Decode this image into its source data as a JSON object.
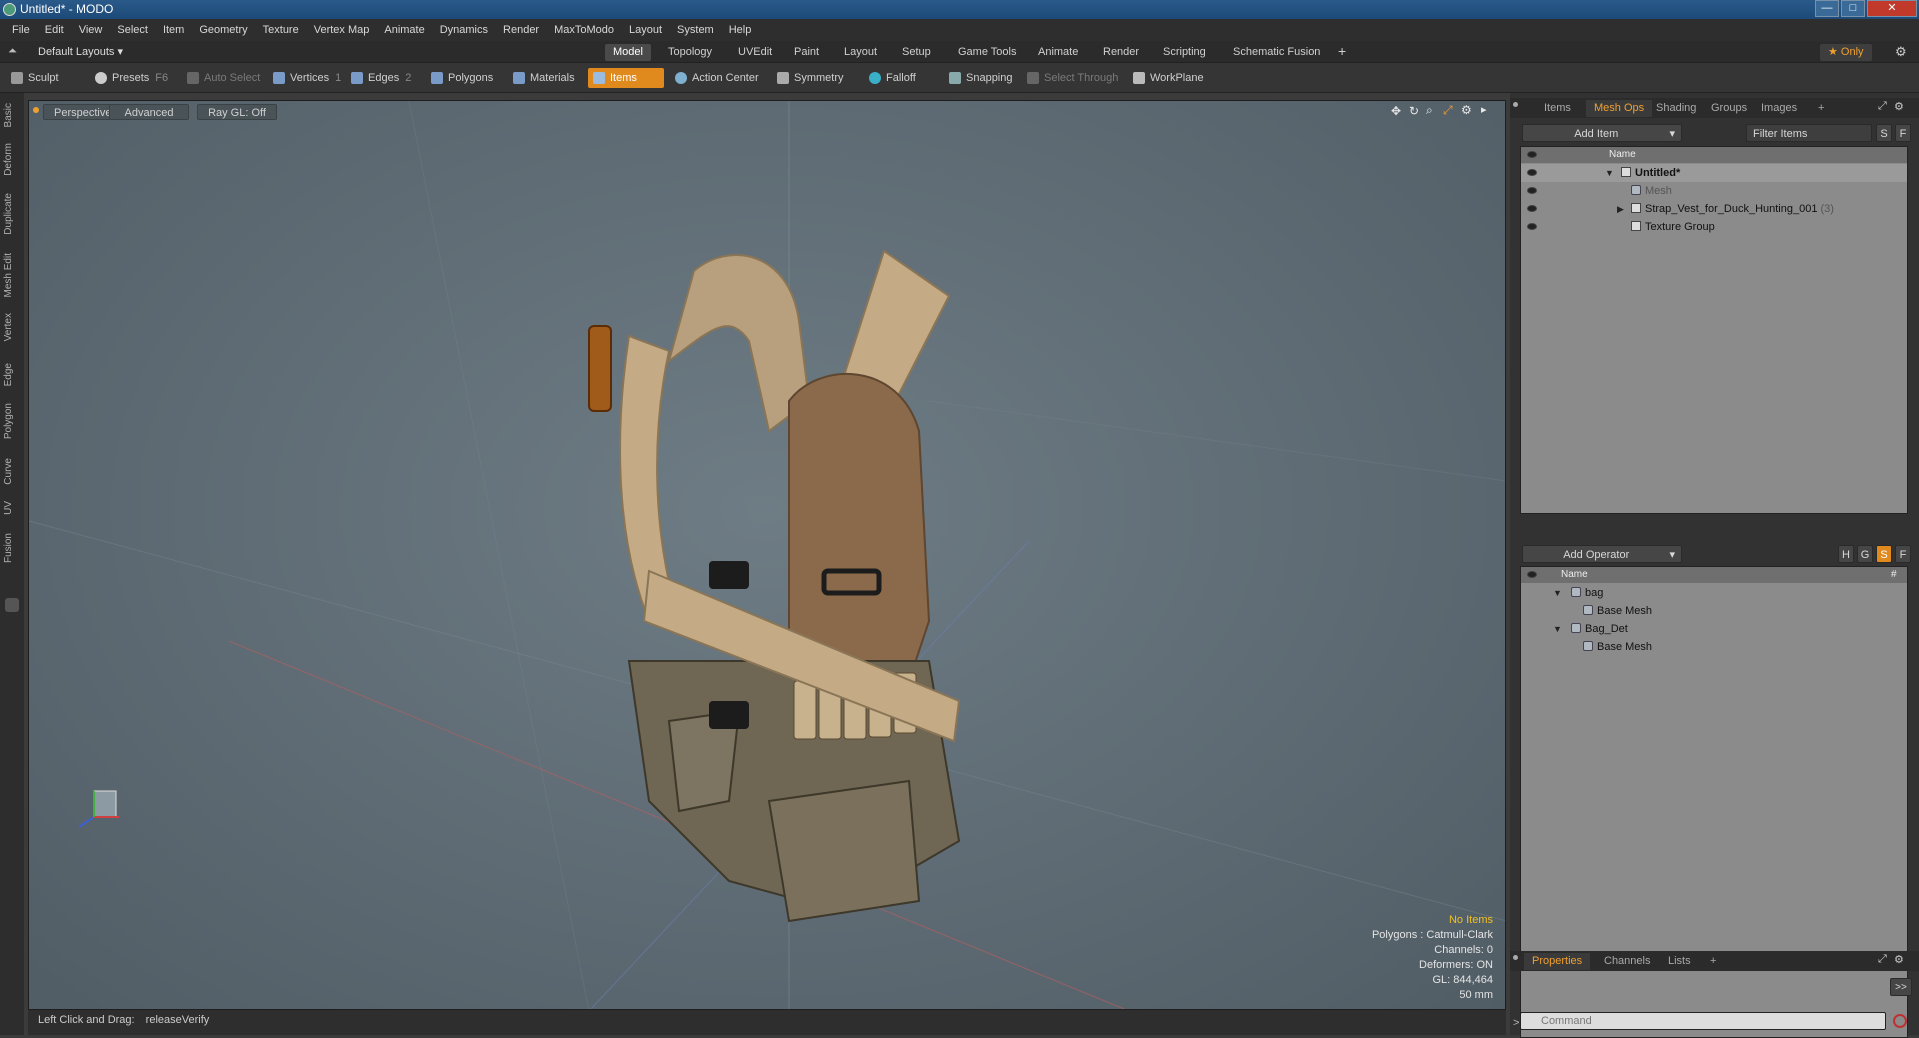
{
  "window": {
    "title": "Untitled* - MODO",
    "min_glyph": "—",
    "max_glyph": "□",
    "close_glyph": "✕"
  },
  "menu": [
    "File",
    "Edit",
    "View",
    "Select",
    "Item",
    "Geometry",
    "Texture",
    "Vertex Map",
    "Animate",
    "Dynamics",
    "Render",
    "MaxToModo",
    "Layout",
    "System",
    "Help"
  ],
  "layouts": {
    "selector": "Default Layouts",
    "tabs": [
      "Model",
      "Topology",
      "UVEdit",
      "Paint",
      "Layout",
      "Setup",
      "Game Tools",
      "Animate",
      "Render",
      "Scripting",
      "Schematic Fusion"
    ],
    "active": "Model",
    "add": "+",
    "only_label": "★ Only"
  },
  "toolbar": {
    "sculpt": "Sculpt",
    "presets": "Presets",
    "presets_key": "F6",
    "auto_select": "Auto Select",
    "vertices": "Vertices",
    "vertices_key": "1",
    "edges": "Edges",
    "edges_key": "2",
    "polygons": "Polygons",
    "materials": "Materials",
    "items": "Items",
    "action_center": "Action Center",
    "symmetry": "Symmetry",
    "falloff": "Falloff",
    "snapping": "Snapping",
    "select_through": "Select Through",
    "workplane": "WorkPlane"
  },
  "left_tabs": [
    "Basic",
    "Deform",
    "Duplicate",
    "Mesh Edit",
    "Vertex",
    "Edge",
    "Polygon",
    "Curve",
    "UV",
    "Fusion"
  ],
  "viewport": {
    "view": "Perspective",
    "shading": "Advanced",
    "raygl": "Ray GL: Off",
    "info": {
      "selection": "No Items",
      "polygons": "Polygons : Catmull-Clark",
      "channels": "Channels: 0",
      "deformers": "Deformers: ON",
      "gl": "GL: 844,464",
      "scale": "50 mm"
    }
  },
  "status": {
    "hint": "Left Click and Drag:",
    "action": "releaseVerify"
  },
  "items_panel": {
    "tabs": [
      "Items",
      "Mesh Ops",
      "Shading",
      "Groups",
      "Images",
      "+"
    ],
    "active": "Mesh Ops",
    "add_item": "Add Item",
    "filter_placeholder": "Filter Items",
    "s_btn": "S",
    "f_btn": "F",
    "col_name": "Name",
    "rows": [
      {
        "name": "Untitled*",
        "depth": 0
      },
      {
        "name": "Mesh",
        "depth": 1
      },
      {
        "name": "Strap_Vest_for_Duck_Hunting_001",
        "count": "(3)",
        "depth": 1
      },
      {
        "name": "Texture Group",
        "depth": 1
      }
    ]
  },
  "meshops_panel": {
    "add_operator": "Add Operator",
    "btn_h": "H",
    "btn_g": "G",
    "btn_s": "S",
    "btn_f": "F",
    "col_name": "Name",
    "col_hash": "#",
    "rows": [
      {
        "name": "bag",
        "depth": 0
      },
      {
        "name": "Base Mesh",
        "depth": 1
      },
      {
        "name": "Bag_Det",
        "depth": 0
      },
      {
        "name": "Base Mesh",
        "depth": 1
      }
    ]
  },
  "properties_panel": {
    "tabs": [
      "Properties",
      "Channels",
      "Lists",
      "+"
    ],
    "active": "Properties",
    "expand": ">>"
  },
  "command": {
    "placeholder": "Command",
    "prompt": ">"
  },
  "colors": {
    "accent": "#e08a1e",
    "viewport": "#5f6c74"
  }
}
